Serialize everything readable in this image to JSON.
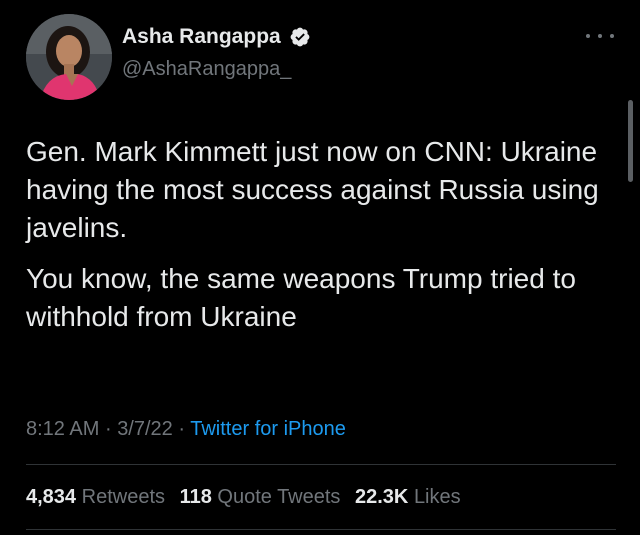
{
  "author": {
    "display_name": "Asha Rangappa",
    "handle": "@AshaRangappa_",
    "verified": true,
    "avatar_icon": "profile-photo"
  },
  "tweet": {
    "paragraphs": [
      "Gen. Mark Kimmett just now on CNN: Ukraine having the most success against Russia using javelins.",
      "You know, the same weapons Trump tried to withhold from Ukraine"
    ]
  },
  "meta": {
    "time": "8:12 AM",
    "separator": "·",
    "date": "3/7/22",
    "source": "Twitter for iPhone"
  },
  "stats": {
    "retweets_count": "4,834",
    "retweets_label": "Retweets",
    "quotes_count": "118",
    "quotes_label": "Quote Tweets",
    "likes_count": "22.3K",
    "likes_label": "Likes"
  },
  "colors": {
    "background": "#000000",
    "text": "#e7e9ea",
    "secondary": "#71767b",
    "accent": "#1d9bf0",
    "divider": "#2f3336"
  }
}
